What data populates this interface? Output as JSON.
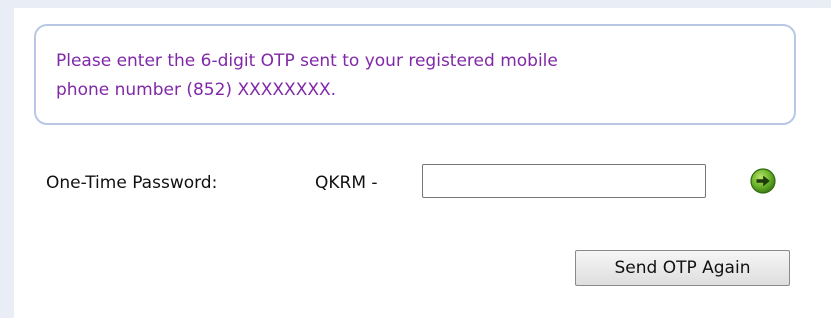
{
  "message": {
    "line1": "Please enter the 6-digit OTP sent to your registered mobile",
    "line2": "phone number (852) XXXXXXXX."
  },
  "otp": {
    "label": "One-Time Password:",
    "prefix": "QKRM -",
    "value": "",
    "submit_icon": "green-arrow-right-icon"
  },
  "actions": {
    "resend_label": "Send OTP Again"
  },
  "colors": {
    "message_text": "#8029a8",
    "message_border": "#b8c8e4",
    "arrow_green": "#5aa51f"
  }
}
